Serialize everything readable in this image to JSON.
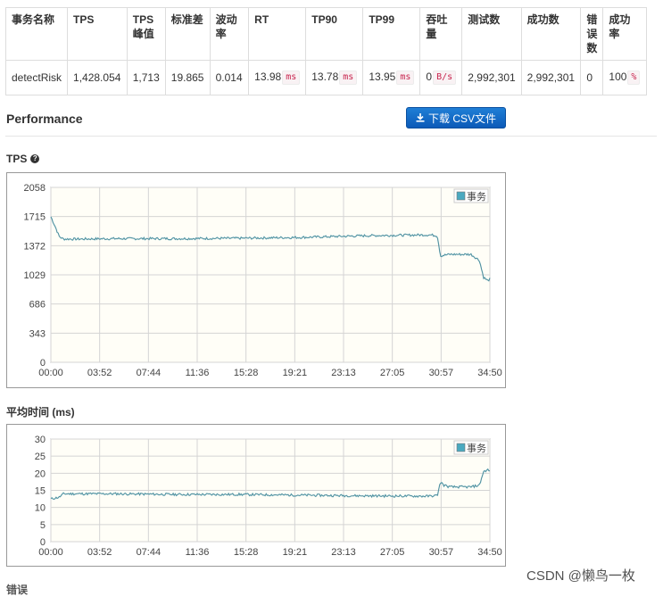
{
  "stats_table": {
    "headers": [
      "事务名称",
      "TPS",
      "TPS\n峰值",
      "标准差",
      "波动\n率",
      "RT",
      "TP90",
      "TP99",
      "吞吐\n量",
      "测试数",
      "成功数",
      "错\n误\n数",
      "成功\n率"
    ],
    "row": [
      {
        "value": "detectRisk",
        "unit": ""
      },
      {
        "value": "1,428.054",
        "unit": ""
      },
      {
        "value": "1,713",
        "unit": ""
      },
      {
        "value": "19.865",
        "unit": ""
      },
      {
        "value": "0.014",
        "unit": ""
      },
      {
        "value": "13.98",
        "unit": "ms"
      },
      {
        "value": "13.78",
        "unit": "ms"
      },
      {
        "value": "13.95",
        "unit": "ms"
      },
      {
        "value": "0",
        "unit": "B/s"
      },
      {
        "value": "2,992,301",
        "unit": ""
      },
      {
        "value": "2,992,301",
        "unit": ""
      },
      {
        "value": "0",
        "unit": ""
      },
      {
        "value": "100",
        "unit": "%"
      }
    ]
  },
  "performance": {
    "title": "Performance",
    "download_label": "下载 CSV文件"
  },
  "colors": {
    "series_line": "#5ea7b7",
    "series_legend": "#4aa9c0",
    "plot_bg": "#fffef7",
    "grid": "#d4d4d4",
    "button": "#1266c7"
  },
  "chart_data": [
    {
      "type": "line",
      "title": "TPS",
      "legend": [
        "事务"
      ],
      "legend_position": "top-right",
      "grid": true,
      "x_ticks": [
        "00:00",
        "03:52",
        "07:44",
        "11:36",
        "15:28",
        "19:21",
        "23:13",
        "27:05",
        "30:57",
        "34:50"
      ],
      "y_ticks": [
        "2058",
        "1715",
        "1372",
        "1029",
        "686",
        "343",
        "0"
      ],
      "xlim": [
        0,
        2090
      ],
      "ylim": [
        0,
        2058
      ],
      "series": [
        {
          "name": "事务",
          "x": [
            0,
            20,
            40,
            60,
            120,
            300,
            600,
            900,
            1200,
            1500,
            1800,
            1840,
            1855,
            1870,
            1900,
            2000,
            2040,
            2060,
            2080,
            2090
          ],
          "y": [
            1713,
            1600,
            1480,
            1450,
            1450,
            1455,
            1455,
            1460,
            1470,
            1490,
            1500,
            1490,
            1250,
            1260,
            1270,
            1270,
            1200,
            1000,
            960,
            980
          ]
        }
      ]
    },
    {
      "type": "line",
      "title": "平均时间 (ms)",
      "legend": [
        "事务"
      ],
      "legend_position": "top-right",
      "grid": true,
      "x_ticks": [
        "00:00",
        "03:52",
        "07:44",
        "11:36",
        "15:28",
        "19:21",
        "23:13",
        "27:05",
        "30:57",
        "34:50"
      ],
      "y_ticks": [
        "30",
        "25",
        "20",
        "15",
        "10",
        "5",
        "0"
      ],
      "xlim": [
        0,
        2090
      ],
      "ylim": [
        0,
        30
      ],
      "series": [
        {
          "name": "事务",
          "x": [
            0,
            40,
            60,
            300,
            600,
            900,
            1200,
            1500,
            1800,
            1840,
            1855,
            1870,
            1900,
            2000,
            2040,
            2060,
            2080,
            2090
          ],
          "y": [
            12.5,
            13.0,
            14.0,
            14.0,
            13.8,
            13.8,
            13.6,
            13.4,
            13.3,
            13.5,
            17.5,
            16.5,
            16.0,
            16.0,
            16.5,
            20.5,
            21.0,
            20.5
          ]
        }
      ]
    }
  ],
  "watermark": "CSDN @懒鸟一枚",
  "next_section_partial": "错误"
}
